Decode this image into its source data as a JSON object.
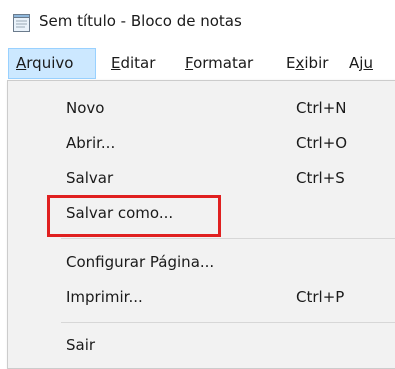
{
  "window": {
    "title": "Sem título - Bloco de notas",
    "icon": "notepad-icon"
  },
  "menubar": {
    "items": [
      {
        "label": "Arquivo",
        "mnemonic": "A",
        "rest": "rquivo"
      },
      {
        "label": "Editar",
        "mnemonic": "E",
        "rest": "ditar"
      },
      {
        "label": "Formatar",
        "mnemonic": "F",
        "rest": "ormatar"
      },
      {
        "label": "Exibir",
        "pre": "E",
        "mnemonic": "x",
        "rest": "ibir"
      },
      {
        "label": "Ajuda",
        "pre": "Aj",
        "mnemonic": "u",
        "rest": ""
      }
    ]
  },
  "dropdown": {
    "items": [
      {
        "label": "Novo",
        "shortcut": "Ctrl+N"
      },
      {
        "label": "Abrir...",
        "shortcut": "Ctrl+O"
      },
      {
        "label": "Salvar",
        "shortcut": "Ctrl+S"
      },
      {
        "label": "Salvar como...",
        "shortcut": ""
      },
      {
        "label": "Configurar Página...",
        "shortcut": ""
      },
      {
        "label": "Imprimir...",
        "shortcut": "Ctrl+P"
      },
      {
        "label": "Sair",
        "shortcut": ""
      }
    ]
  },
  "colors": {
    "highlight": "#e02020",
    "menu_active": "#cce8ff",
    "dropdown_bg": "#f2f2f2"
  }
}
